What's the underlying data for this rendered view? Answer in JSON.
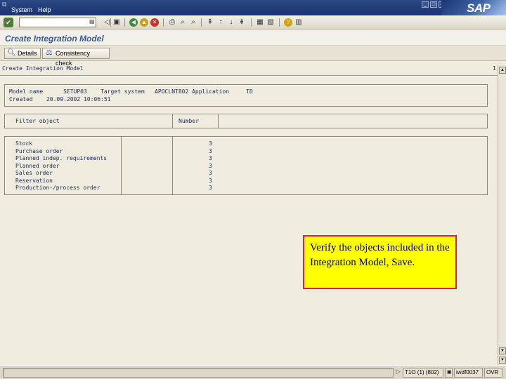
{
  "menubar": {
    "items": [
      {
        "label": "System"
      },
      {
        "label": "Help"
      }
    ]
  },
  "logo": "SAP",
  "screen": {
    "title": "Create Integration Model"
  },
  "app_toolbar": {
    "details_label": "Details",
    "consistency_label": "Consistency check"
  },
  "report": {
    "heading": "Create Integration Model",
    "page_number": "1",
    "header_box": {
      "line1": "Model name      SETUP03    Target system   APOCLNT802 Application     TD",
      "line2": "Created    20.09.2002 10:06:51"
    },
    "columns": {
      "filter_object": "Filter object",
      "number": "Number"
    },
    "rows": [
      {
        "object": "Stock",
        "number": "3"
      },
      {
        "object": "Purchase order",
        "number": "3"
      },
      {
        "object": "Planned indep. requirements",
        "number": "3"
      },
      {
        "object": "Planned order",
        "number": "3"
      },
      {
        "object": "Sales order",
        "number": "3"
      },
      {
        "object": "Reservation",
        "number": "3"
      },
      {
        "object": "Production-/process order",
        "number": "3"
      }
    ]
  },
  "callout": {
    "text": "Verify the objects included in the Integration Model, Save."
  },
  "statusbar": {
    "system": "T1O (1) (802)",
    "server": "iwdf0037",
    "mode": "OVR"
  },
  "colors": {
    "title_blue": "#3a5a98",
    "callout_bg": "#ffff00",
    "callout_border": "#d9262a",
    "menubar_bg": "#1a3470"
  }
}
